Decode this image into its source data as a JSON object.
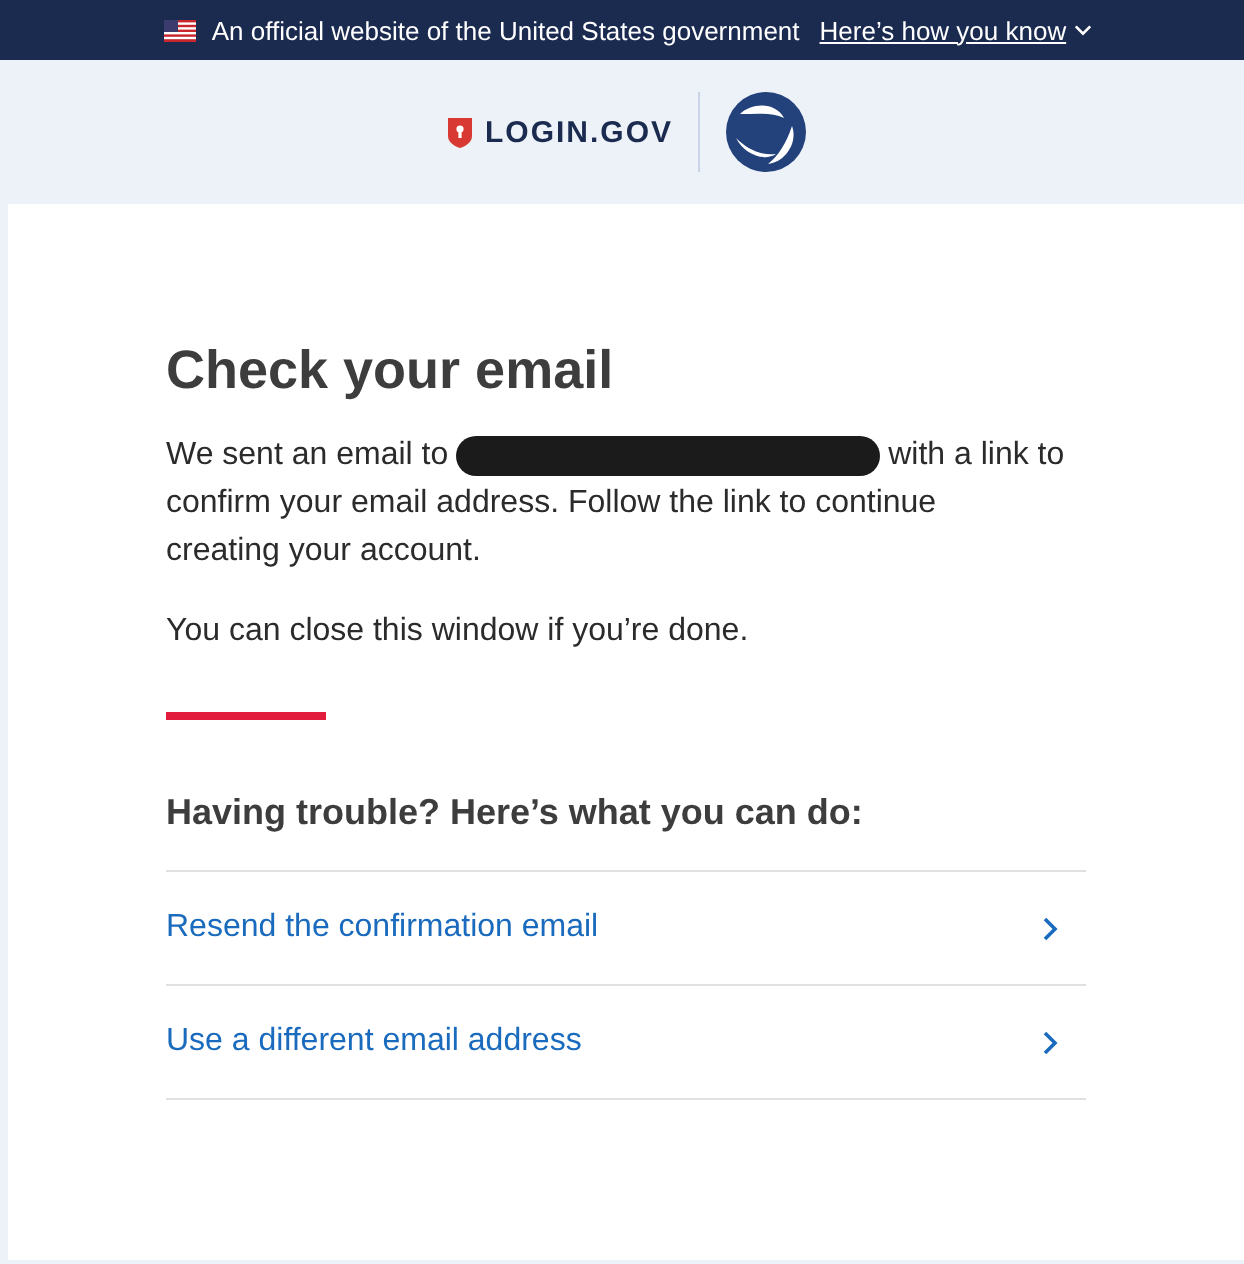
{
  "banner": {
    "text": "An official website of the United States government",
    "link": "Here’s how you know",
    "expanded": false
  },
  "header": {
    "logo_text": "LOGIN.GOV"
  },
  "content": {
    "title": "Check your email",
    "message": {
      "before_redaction": "We sent an email to",
      "after_redaction": "with a link to",
      "continuation": "confirm your email address. Follow the link to continue creating your account."
    },
    "note": "You can close this window if you’re done.",
    "help_heading": "Having trouble? Here’s what you can do:",
    "options": [
      {
        "label": "Resend the confirmation email"
      },
      {
        "label": "Use a different email address"
      }
    ]
  }
}
